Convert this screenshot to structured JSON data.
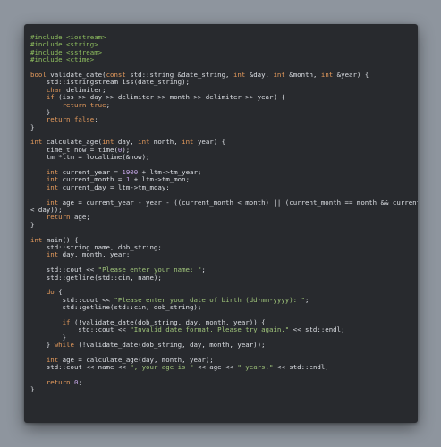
{
  "code": {
    "lines": [
      [
        {
          "t": "#include <iostream>",
          "c": "inc"
        }
      ],
      [
        {
          "t": "#include <string>",
          "c": "inc"
        }
      ],
      [
        {
          "t": "#include <sstream>",
          "c": "inc"
        }
      ],
      [
        {
          "t": "#include <ctime>",
          "c": "inc"
        }
      ],
      [],
      [
        {
          "t": "bool",
          "c": "kw"
        },
        {
          "t": " validate_date(",
          "c": "plain"
        },
        {
          "t": "const",
          "c": "kw"
        },
        {
          "t": " std::string &date_string, ",
          "c": "plain"
        },
        {
          "t": "int",
          "c": "kw"
        },
        {
          "t": " &day, ",
          "c": "plain"
        },
        {
          "t": "int",
          "c": "kw"
        },
        {
          "t": " &month, ",
          "c": "plain"
        },
        {
          "t": "int",
          "c": "kw"
        },
        {
          "t": " &year) {",
          "c": "plain"
        }
      ],
      [
        {
          "t": "    std::istringstream iss(date_string);",
          "c": "plain"
        }
      ],
      [
        {
          "t": "    ",
          "c": "plain"
        },
        {
          "t": "char",
          "c": "kw"
        },
        {
          "t": " delimiter;",
          "c": "plain"
        }
      ],
      [
        {
          "t": "    ",
          "c": "plain"
        },
        {
          "t": "if",
          "c": "kw"
        },
        {
          "t": " (iss >> day >> delimiter >> month >> delimiter >> year) {",
          "c": "plain"
        }
      ],
      [
        {
          "t": "        ",
          "c": "plain"
        },
        {
          "t": "return",
          "c": "kw"
        },
        {
          "t": " ",
          "c": "plain"
        },
        {
          "t": "true",
          "c": "kw"
        },
        {
          "t": ";",
          "c": "plain"
        }
      ],
      [
        {
          "t": "    }",
          "c": "plain"
        }
      ],
      [
        {
          "t": "    ",
          "c": "plain"
        },
        {
          "t": "return",
          "c": "kw"
        },
        {
          "t": " ",
          "c": "plain"
        },
        {
          "t": "false",
          "c": "kw"
        },
        {
          "t": ";",
          "c": "plain"
        }
      ],
      [
        {
          "t": "}",
          "c": "plain"
        }
      ],
      [],
      [
        {
          "t": "int",
          "c": "kw"
        },
        {
          "t": " calculate_age(",
          "c": "plain"
        },
        {
          "t": "int",
          "c": "kw"
        },
        {
          "t": " day, ",
          "c": "plain"
        },
        {
          "t": "int",
          "c": "kw"
        },
        {
          "t": " month, ",
          "c": "plain"
        },
        {
          "t": "int",
          "c": "kw"
        },
        {
          "t": " year) {",
          "c": "plain"
        }
      ],
      [
        {
          "t": "    time_t now = time(",
          "c": "plain"
        },
        {
          "t": "0",
          "c": "num"
        },
        {
          "t": ");",
          "c": "plain"
        }
      ],
      [
        {
          "t": "    tm *ltm = localtime(&now);",
          "c": "plain"
        }
      ],
      [],
      [
        {
          "t": "    ",
          "c": "plain"
        },
        {
          "t": "int",
          "c": "kw"
        },
        {
          "t": " current_year = ",
          "c": "plain"
        },
        {
          "t": "1900",
          "c": "num"
        },
        {
          "t": " + ltm->tm_year;",
          "c": "plain"
        }
      ],
      [
        {
          "t": "    ",
          "c": "plain"
        },
        {
          "t": "int",
          "c": "kw"
        },
        {
          "t": " current_month = ",
          "c": "plain"
        },
        {
          "t": "1",
          "c": "num"
        },
        {
          "t": " + ltm->tm_mon;",
          "c": "plain"
        }
      ],
      [
        {
          "t": "    ",
          "c": "plain"
        },
        {
          "t": "int",
          "c": "kw"
        },
        {
          "t": " current_day = ltm->tm_mday;",
          "c": "plain"
        }
      ],
      [],
      [
        {
          "t": "    ",
          "c": "plain"
        },
        {
          "t": "int",
          "c": "kw"
        },
        {
          "t": " age = current_year - year - ((current_month < month) || (current_month == month && current_day",
          "c": "plain"
        }
      ],
      [
        {
          "t": "< day));",
          "c": "plain"
        }
      ],
      [
        {
          "t": "    ",
          "c": "plain"
        },
        {
          "t": "return",
          "c": "kw"
        },
        {
          "t": " age;",
          "c": "plain"
        }
      ],
      [
        {
          "t": "}",
          "c": "plain"
        }
      ],
      [],
      [
        {
          "t": "int",
          "c": "kw"
        },
        {
          "t": " main() {",
          "c": "plain"
        }
      ],
      [
        {
          "t": "    std::string name, dob_string;",
          "c": "plain"
        }
      ],
      [
        {
          "t": "    ",
          "c": "plain"
        },
        {
          "t": "int",
          "c": "kw"
        },
        {
          "t": " day, month, year;",
          "c": "plain"
        }
      ],
      [],
      [
        {
          "t": "    std::cout << ",
          "c": "plain"
        },
        {
          "t": "\"Please enter your name: \"",
          "c": "str"
        },
        {
          "t": ";",
          "c": "plain"
        }
      ],
      [
        {
          "t": "    std::getline(std::cin, name);",
          "c": "plain"
        }
      ],
      [],
      [
        {
          "t": "    ",
          "c": "plain"
        },
        {
          "t": "do",
          "c": "kw"
        },
        {
          "t": " {",
          "c": "plain"
        }
      ],
      [
        {
          "t": "        std::cout << ",
          "c": "plain"
        },
        {
          "t": "\"Please enter your date of birth (dd-mm-yyyy): \"",
          "c": "str"
        },
        {
          "t": ";",
          "c": "plain"
        }
      ],
      [
        {
          "t": "        std::getline(std::cin, dob_string);",
          "c": "plain"
        }
      ],
      [],
      [
        {
          "t": "        ",
          "c": "plain"
        },
        {
          "t": "if",
          "c": "kw"
        },
        {
          "t": " (!validate_date(dob_string, day, month, year)) {",
          "c": "plain"
        }
      ],
      [
        {
          "t": "            std::cout << ",
          "c": "plain"
        },
        {
          "t": "\"Invalid date format. Please try again.\"",
          "c": "str"
        },
        {
          "t": " << std::endl;",
          "c": "plain"
        }
      ],
      [
        {
          "t": "        }",
          "c": "plain"
        }
      ],
      [
        {
          "t": "    } ",
          "c": "plain"
        },
        {
          "t": "while",
          "c": "kw"
        },
        {
          "t": " (!validate_date(dob_string, day, month, year));",
          "c": "plain"
        }
      ],
      [],
      [
        {
          "t": "    ",
          "c": "plain"
        },
        {
          "t": "int",
          "c": "kw"
        },
        {
          "t": " age = calculate_age(day, month, year);",
          "c": "plain"
        }
      ],
      [
        {
          "t": "    std::cout << name << ",
          "c": "plain"
        },
        {
          "t": "\", your age is \"",
          "c": "str"
        },
        {
          "t": " << age << ",
          "c": "plain"
        },
        {
          "t": "\" years.\"",
          "c": "str"
        },
        {
          "t": " << std::endl;",
          "c": "plain"
        }
      ],
      [],
      [
        {
          "t": "    ",
          "c": "plain"
        },
        {
          "t": "return",
          "c": "kw"
        },
        {
          "t": " ",
          "c": "plain"
        },
        {
          "t": "0",
          "c": "num"
        },
        {
          "t": ";",
          "c": "plain"
        }
      ],
      [
        {
          "t": "}",
          "c": "plain"
        }
      ]
    ]
  },
  "colors": {
    "background": "#8e959e",
    "editor": "#282a2e",
    "keyword": "#e49a5c",
    "include": "#8fbf5f",
    "string": "#9fc47a",
    "number": "#c6a7e8",
    "text": "#dcdfe4"
  }
}
